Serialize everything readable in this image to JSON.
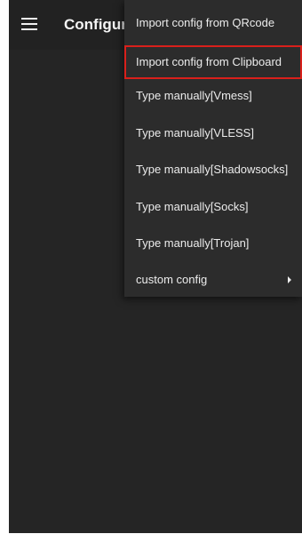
{
  "appbar": {
    "icon": "hamburger-menu-icon",
    "title": "Configur"
  },
  "dropdown": {
    "items": [
      {
        "label": "Import config from QRcode",
        "highlighted": false
      },
      {
        "label": "Import config from Clipboard",
        "highlighted": true
      },
      {
        "label": "Type manually[Vmess]",
        "highlighted": false
      },
      {
        "label": "Type manually[VLESS]",
        "highlighted": false
      },
      {
        "label": "Type manually[Shadowsocks]",
        "highlighted": false
      },
      {
        "label": "Type manually[Socks]",
        "highlighted": false
      },
      {
        "label": "Type manually[Trojan]",
        "highlighted": false
      },
      {
        "label": "custom config",
        "highlighted": false,
        "submenu_icon": "submenu-arrow-icon"
      }
    ]
  },
  "colors": {
    "background": "#252525",
    "menu_background": "#2c2c2c",
    "highlight_border": "#d9201b",
    "text": "#ececec"
  }
}
